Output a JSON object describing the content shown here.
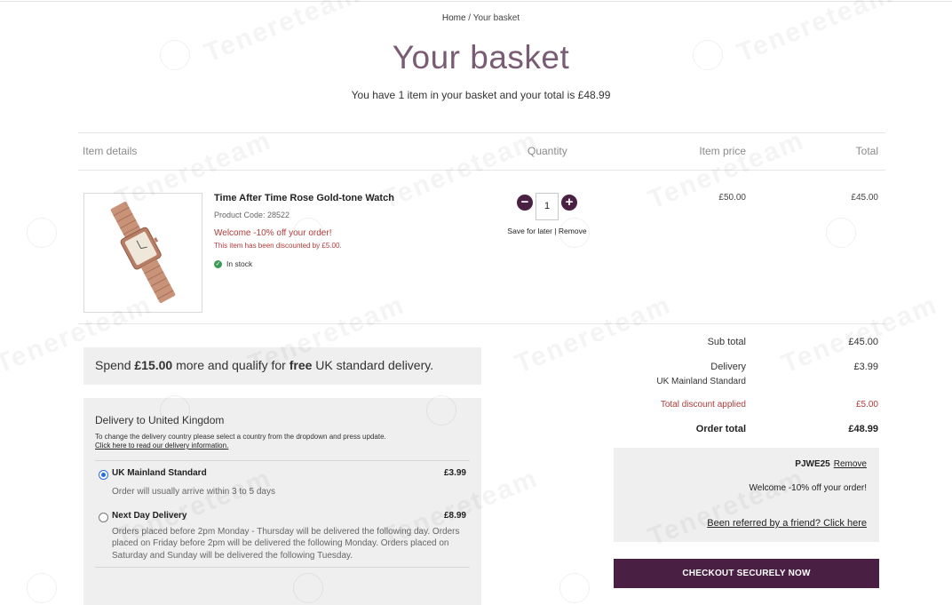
{
  "breadcrumb": {
    "home": "Home",
    "separator": " / ",
    "current": "Your basket"
  },
  "page": {
    "title": "Your basket",
    "summary": "You have 1 item in your basket and your total is £48.99"
  },
  "table_headers": {
    "item_details": "Item details",
    "quantity": "Quantity",
    "item_price": "Item price",
    "total": "Total"
  },
  "item": {
    "name": "Time After Time Rose Gold-tone Watch",
    "product_code": "Product Code: 28522",
    "promo": "Welcome -10% off your order!",
    "discount_note": "This item has been discounted by £5.00.",
    "stock": "In stock",
    "quantity": "1",
    "minus_label": "−",
    "plus_label": "+",
    "save_for_later": "Save for later",
    "links_separator": " | ",
    "remove": "Remove",
    "price": "£50.00",
    "total": "£45.00"
  },
  "free_delivery": {
    "prefix": "Spend ",
    "amount": "£15.00",
    "middle": " more and qualify for ",
    "free": "free",
    "suffix": " UK standard delivery."
  },
  "delivery": {
    "title": "Delivery to United Kingdom",
    "note": "To change the delivery country please select a country from the dropdown and press update.",
    "link": "Click here to read our delivery information",
    "link_suffix": ".",
    "options": [
      {
        "name": "UK Mainland Standard",
        "price": "£3.99",
        "desc": "Order will usually arrive within 3 to 5 days",
        "selected": true
      },
      {
        "name": "Next Day Delivery",
        "price": "£8.99",
        "desc": "Orders placed before 2pm Monday - Thursday will be delivered the following day. Orders placed on Friday before 2pm will be delivered the following Monday. Orders placed on Saturday and Sunday will be delivered the following Tuesday.",
        "selected": false
      }
    ]
  },
  "totals": {
    "sub_total_label": "Sub total",
    "sub_total": "£45.00",
    "delivery_label": "Delivery",
    "delivery_method": "UK Mainland Standard",
    "delivery": "£3.99",
    "discount_label": "Total discount applied",
    "discount": "£5.00",
    "order_total_label": "Order total",
    "order_total": "£48.99"
  },
  "voucher": {
    "code": "PJWE25",
    "remove": "Remove",
    "description": "Welcome -10% off your order!",
    "referral": "Been referred by a friend? Click here"
  },
  "checkout": {
    "label": "CHECKOUT SECURELY NOW"
  },
  "watermark": {
    "text": "Tenereteam",
    "logo_text": "tenere"
  },
  "colors": {
    "brand": "#4a1f44",
    "title": "#7a5b74",
    "discount_red": "#b13c3c",
    "stock_green": "#3c9a55",
    "panel_bg": "#efefef"
  }
}
